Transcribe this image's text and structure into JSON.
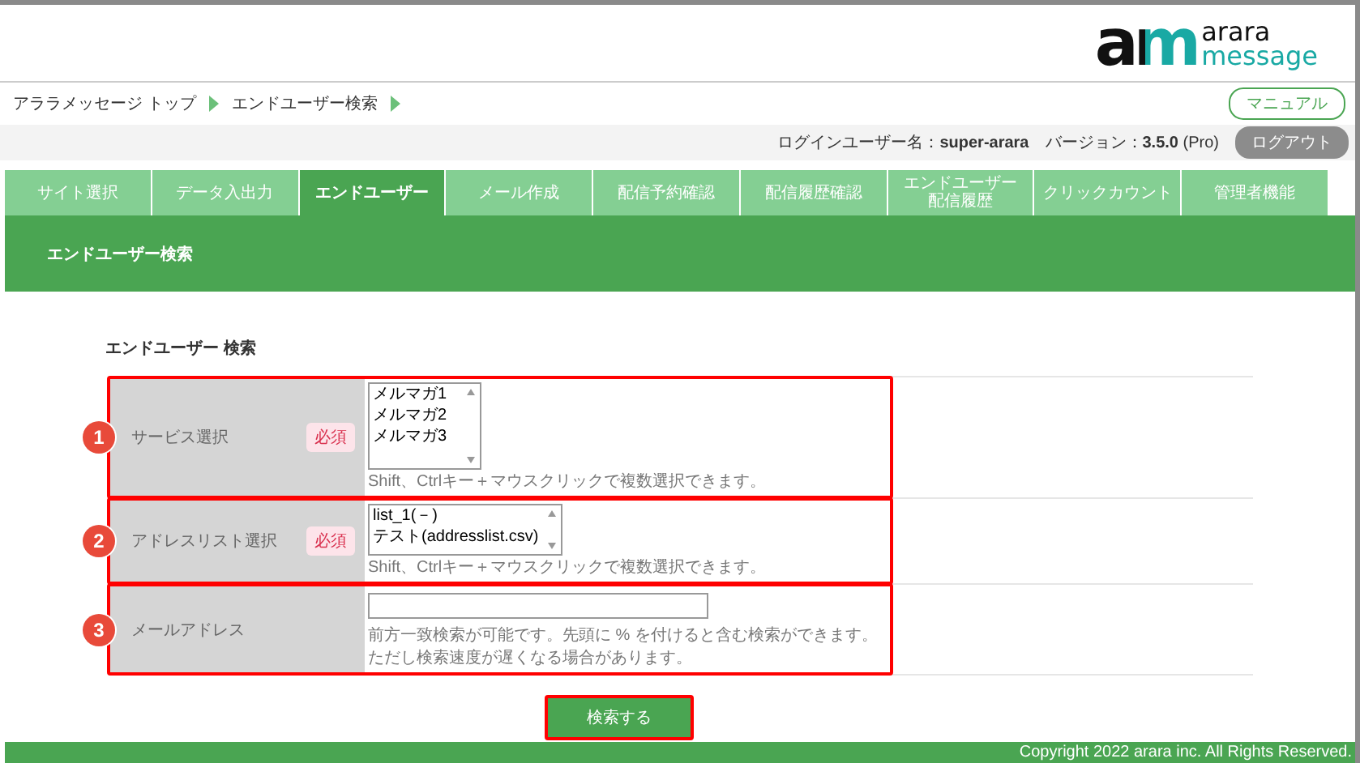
{
  "logo": {
    "mark": "am",
    "line1": "arara",
    "line2": "message"
  },
  "breadcrumb": [
    "アララメッセージ トップ",
    "エンドユーザー検索"
  ],
  "manual_button": "マニュアル",
  "login": {
    "label": "ログインユーザー名：",
    "user": "super-arara",
    "version_label": "バージョン：",
    "version": "3.5.0",
    "edition": "(Pro)",
    "logout": "ログアウト"
  },
  "tabs": [
    {
      "label": "サイト選択",
      "selected": false
    },
    {
      "label": "データ入出力",
      "selected": false
    },
    {
      "label": "エンドユーザー",
      "selected": true
    },
    {
      "label": "メール作成",
      "selected": false
    },
    {
      "label": "配信予約確認",
      "selected": false
    },
    {
      "label": "配信履歴確認",
      "selected": false
    },
    {
      "label": "エンドユーザー",
      "label_line2": "配信履歴",
      "selected": false
    },
    {
      "label": "クリックカウント",
      "selected": false
    },
    {
      "label": "管理者機能",
      "selected": false
    }
  ],
  "subnav": "エンドユーザー検索",
  "form": {
    "heading": "エンドユーザー 検索",
    "rows": [
      {
        "kind": "select",
        "marker": "1",
        "label": "サービス選択",
        "required": "必須",
        "options": [
          "メルマガ1",
          "メルマガ2",
          "メルマガ3"
        ],
        "notes": [
          "Shift、Ctrlキー＋マウスクリックで複数選択できます。"
        ]
      },
      {
        "kind": "select",
        "marker": "2",
        "label": "アドレスリスト選択",
        "required": "必須",
        "options": [
          "list_1(－)",
          "テスト(addresslist.csv)"
        ],
        "notes": [
          "Shift、Ctrlキー＋マウスクリックで複数選択できます。"
        ]
      },
      {
        "kind": "text",
        "marker": "3",
        "label": "メールアドレス",
        "notes": [
          "前方一致検索が可能です。先頭に % を付けると含む検索ができます。",
          "ただし検索速度が遅くなる場合があります。"
        ]
      }
    ],
    "submit": "検索する"
  },
  "footer": "Copyright 2022 arara inc. All Rights Reserved."
}
